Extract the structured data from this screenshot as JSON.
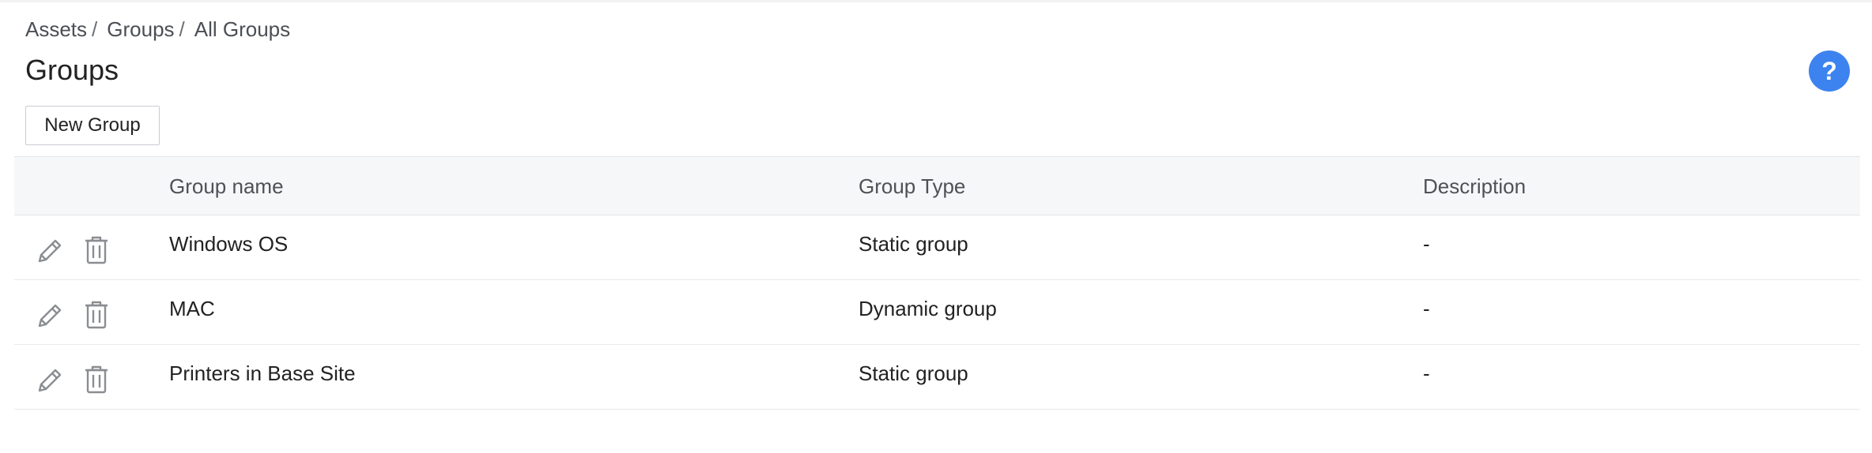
{
  "breadcrumb": {
    "items": [
      "Assets",
      "Groups",
      "All Groups"
    ],
    "separator": "/"
  },
  "page": {
    "title": "Groups"
  },
  "help": {
    "label": "?"
  },
  "toolbar": {
    "new_group_label": "New Group"
  },
  "table": {
    "columns": [
      "Group name",
      "Group Type",
      "Description"
    ],
    "rows": [
      {
        "name": "Windows OS",
        "type": "Static group",
        "description": "-"
      },
      {
        "name": "MAC",
        "type": "Dynamic group",
        "description": "-"
      },
      {
        "name": "Printers in Base Site",
        "type": "Static group",
        "description": "-"
      }
    ],
    "row_actions": [
      "pencil-icon",
      "trash-icon"
    ]
  },
  "colors": {
    "accent": "#3d83f0",
    "header_bg": "#f6f7f8",
    "icon": "#8a8d91"
  }
}
